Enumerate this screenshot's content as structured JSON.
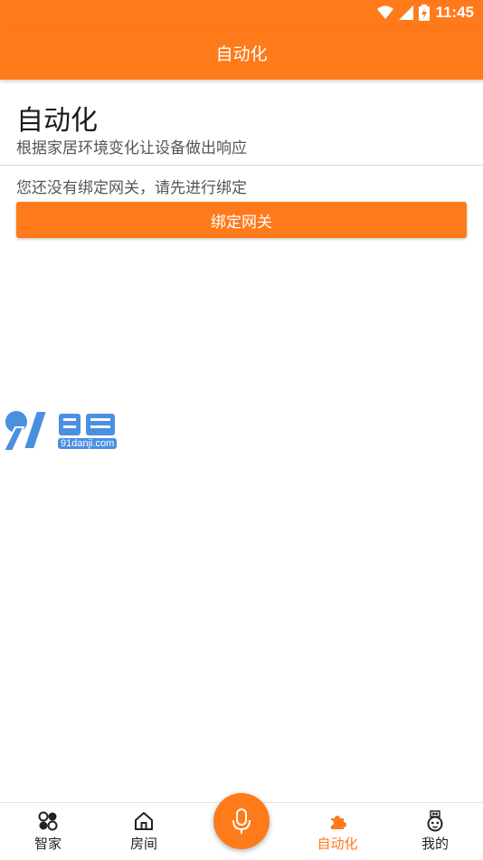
{
  "status_bar": {
    "time": "11:45"
  },
  "app_bar": {
    "title": "自动化"
  },
  "header": {
    "title": "自动化",
    "subtitle": "根据家居环境变化让设备做出响应"
  },
  "notice": {
    "text": "您还没有绑定网关，请先进行绑定"
  },
  "bind_button": {
    "label": "绑定网关"
  },
  "watermark": {
    "logo_text": "91游戏",
    "domain": "91danji.com"
  },
  "bottom_nav": {
    "items": [
      {
        "label": "智家",
        "icon": "four-circles-icon"
      },
      {
        "label": "房间",
        "icon": "house-icon"
      },
      {
        "label": "自动化",
        "icon": "puzzle-icon",
        "active": true
      },
      {
        "label": "我的",
        "icon": "robot-face-icon"
      }
    ],
    "mic_icon": "microphone-icon"
  },
  "colors": {
    "accent": "#ff7a1a",
    "watermark_blue": "#4a8fe0"
  }
}
